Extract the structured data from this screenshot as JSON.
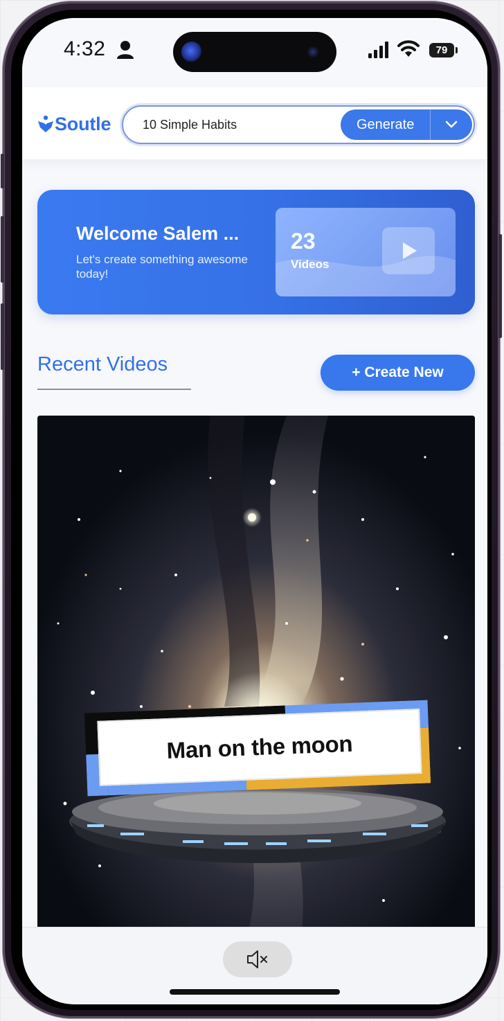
{
  "status_bar": {
    "time": "4:32",
    "battery": "79",
    "icons": [
      "person-icon",
      "signal-icon",
      "wifi-icon",
      "battery-icon"
    ]
  },
  "header": {
    "logo_text": "Soutle",
    "search_value": "10 Simple Habits",
    "generate_label": "Generate"
  },
  "welcome": {
    "title": "Welcome Salem ...",
    "subtitle": "Let's create something awesome today!",
    "video_count": "23",
    "video_count_label": "Videos"
  },
  "recent": {
    "title": "Recent Videos",
    "create_label": "+ Create New"
  },
  "video": {
    "caption": "Man on the moon"
  },
  "colors": {
    "brand": "#3170e8",
    "caption_accent_blue": "#6b9cf2",
    "caption_accent_yellow": "#e9ad32"
  }
}
